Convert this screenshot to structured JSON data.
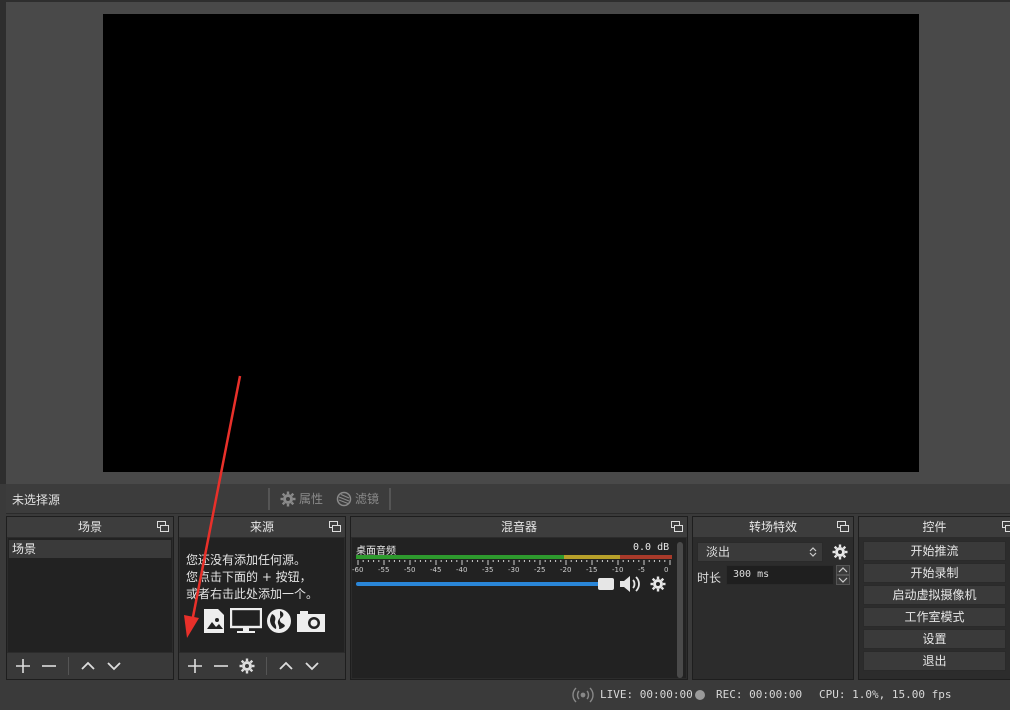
{
  "source_toolbar": {
    "no_source_label": "未选择源",
    "properties_label": "属性",
    "filters_label": "滤镜"
  },
  "docks": {
    "scenes": {
      "title": "场景",
      "items": [
        "场景"
      ]
    },
    "sources": {
      "title": "来源",
      "empty_lines": "您还没有添加任何源。\n您点击下面的 + 按钮，\n或者右击此处添加一个。"
    },
    "mixer": {
      "title": "混音器",
      "channel_name": "桌面音频",
      "level_readout": "0.0 dB",
      "scale_ticks": [
        "-60",
        "-55",
        "-50",
        "-45",
        "-40",
        "-35",
        "-30",
        "-25",
        "-20",
        "-15",
        "-10",
        "-5",
        "0"
      ],
      "volume_fraction": 1.0
    },
    "transitions": {
      "title": "转场特效",
      "selected_transition": "淡出",
      "duration_label": "时长",
      "duration_value": "300 ms"
    },
    "controls": {
      "title": "控件",
      "buttons": [
        "开始推流",
        "开始录制",
        "启动虚拟摄像机",
        "工作室模式",
        "设置",
        "退出"
      ]
    }
  },
  "status": {
    "live": "LIVE: 00:00:00",
    "rec": "REC: 00:00:00",
    "cpu": "CPU: 1.0%, 15.00 fps"
  },
  "colors": {
    "annotation_arrow": "#e8302a",
    "meter_green": "#2e9a2e",
    "meter_yellow": "#b7a02a",
    "meter_red": "#a83a2a",
    "volume_slider": "#2a86d8"
  }
}
